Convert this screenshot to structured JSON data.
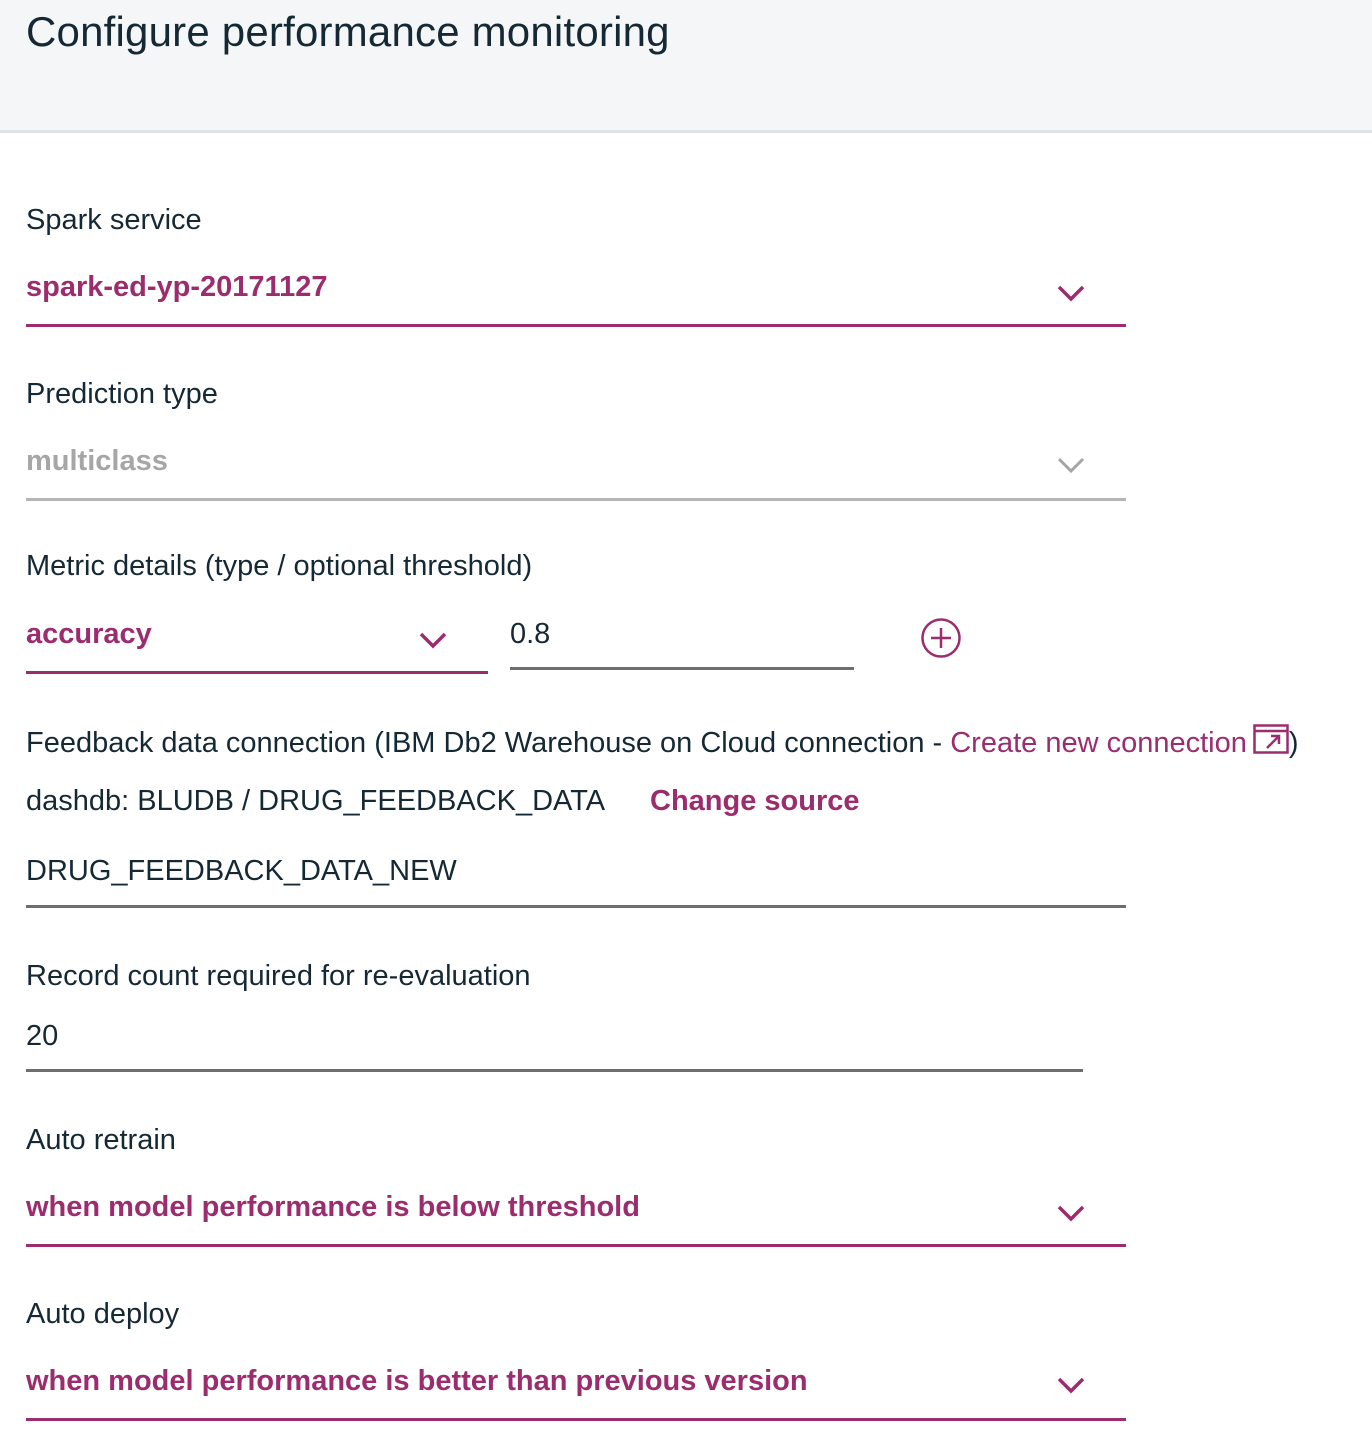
{
  "header": {
    "title": "Configure performance monitoring"
  },
  "spark_service": {
    "label": "Spark service",
    "value": "spark-ed-yp-20171127"
  },
  "prediction_type": {
    "label": "Prediction type",
    "value": "multiclass"
  },
  "metric_details": {
    "label": "Metric details (type / optional threshold)",
    "type_value": "accuracy",
    "threshold_value": "0.8"
  },
  "feedback": {
    "label_prefix": "Feedback data connection (IBM Db2 Warehouse on Cloud connection - ",
    "create_link": "Create new connection",
    "label_suffix": ")",
    "source_text": "dashdb: BLUDB / DRUG_FEEDBACK_DATA",
    "change_source_label": "Change source",
    "table_value": "DRUG_FEEDBACK_DATA_NEW"
  },
  "record_count": {
    "label": "Record count required for re-evaluation",
    "value": "20"
  },
  "auto_retrain": {
    "label": "Auto retrain",
    "value": "when model performance is below threshold"
  },
  "auto_deploy": {
    "label": "Auto deploy",
    "value": "when model performance is better than previous version"
  },
  "colors": {
    "accent": "#9b2d6f",
    "text": "#152935",
    "disabled": "#a4a6a8",
    "header_bg": "#f5f6f8"
  }
}
